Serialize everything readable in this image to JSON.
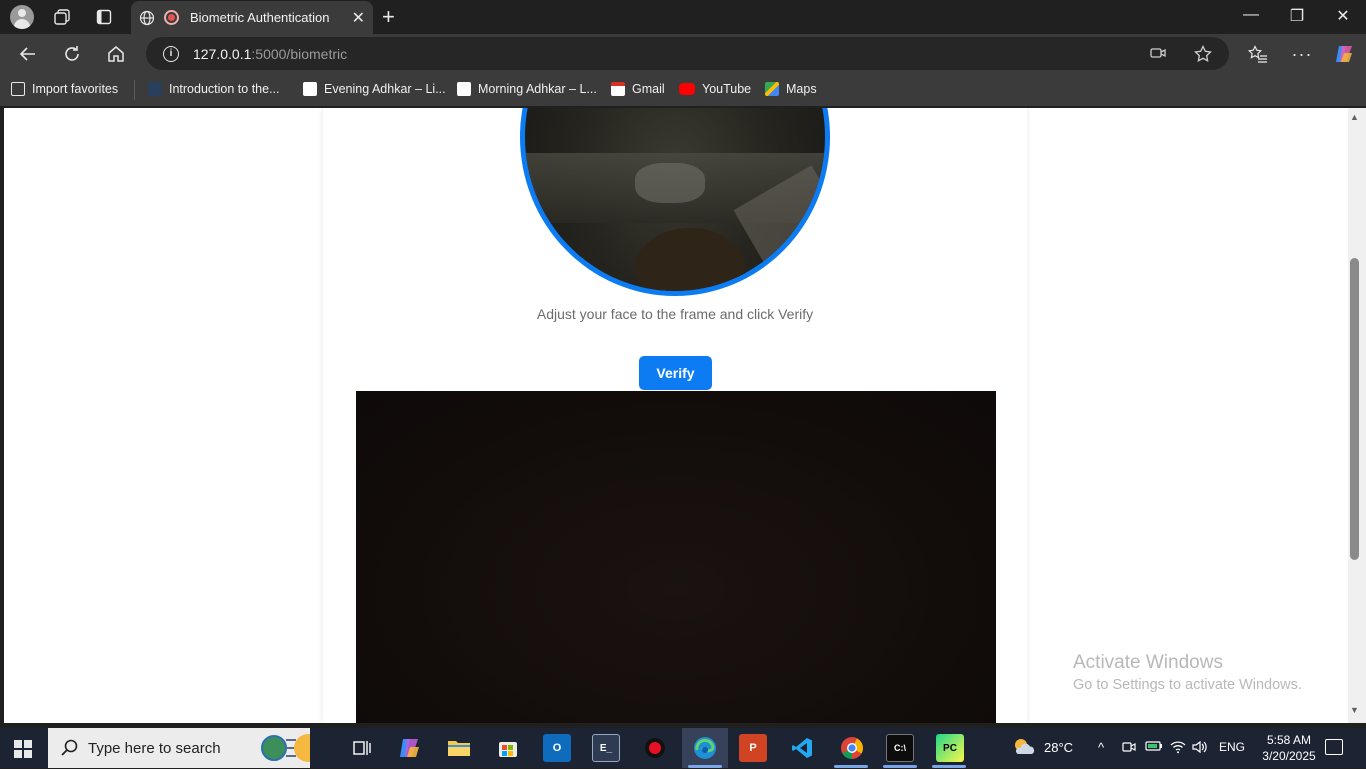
{
  "browser": {
    "tab_title": "Biometric Authentication",
    "tab_close": "✕",
    "new_tab": "+",
    "window_controls": {
      "minimize": "—",
      "restore": "❐",
      "close": "✕"
    },
    "url_host": "127.0.0.1",
    "url_rest": ":5000/biometric",
    "favorites": [
      {
        "label": "Import favorites"
      },
      {
        "label": "Introduction to the..."
      },
      {
        "label": "Evening Adhkar – Li..."
      },
      {
        "label": "Morning Adhkar – L..."
      },
      {
        "label": "Gmail"
      },
      {
        "label": "YouTube"
      },
      {
        "label": "Maps"
      }
    ]
  },
  "page": {
    "hint": "Adjust your face to the frame and click Verify",
    "verify_label": "Verify",
    "accent_color": "#0d7cf2"
  },
  "watermark": {
    "line1": "Activate Windows",
    "line2": "Go to Settings to activate Windows."
  },
  "taskbar": {
    "search_placeholder": "Type here to search",
    "weather": "28°C",
    "language": "ENG",
    "time": "5:58 AM",
    "date": "3/20/2025"
  }
}
